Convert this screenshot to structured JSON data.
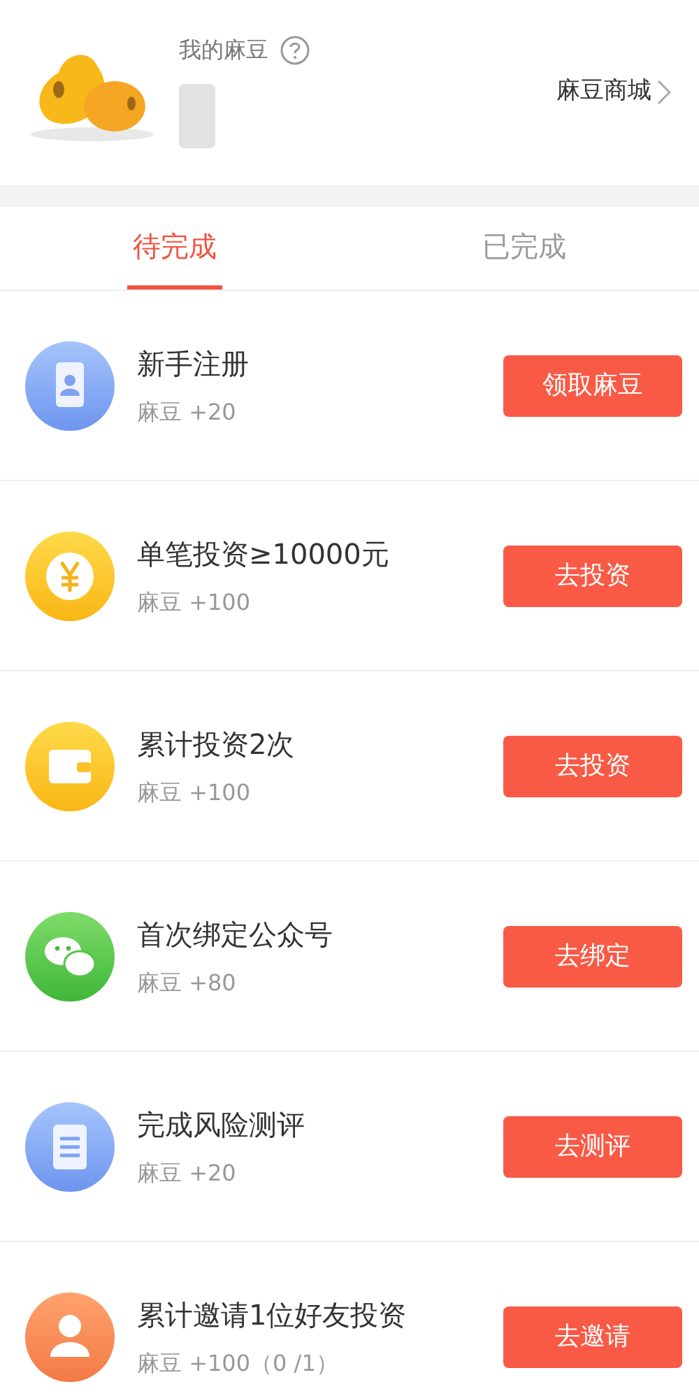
{
  "header": {
    "label": "我的麻豆",
    "shop_link": "麻豆商城"
  },
  "tabs": [
    {
      "label": "待完成",
      "selected": true
    },
    {
      "label": "已完成",
      "selected": false
    }
  ],
  "tasks": [
    {
      "title": "新手注册",
      "reward": "麻豆 +20",
      "button": "领取麻豆"
    },
    {
      "title": "单笔投资≥10000元",
      "reward": "麻豆 +100",
      "button": "去投资"
    },
    {
      "title": "累计投资2次",
      "reward": "麻豆 +100",
      "button": "去投资"
    },
    {
      "title": "首次绑定公众号",
      "reward": "麻豆 +80",
      "button": "去绑定"
    },
    {
      "title": "完成风险测评",
      "reward": "麻豆 +20",
      "button": "去测评"
    },
    {
      "title": "累计邀请1位好友投资",
      "reward": "麻豆 +100（0 /1）",
      "button": "去邀请"
    }
  ]
}
